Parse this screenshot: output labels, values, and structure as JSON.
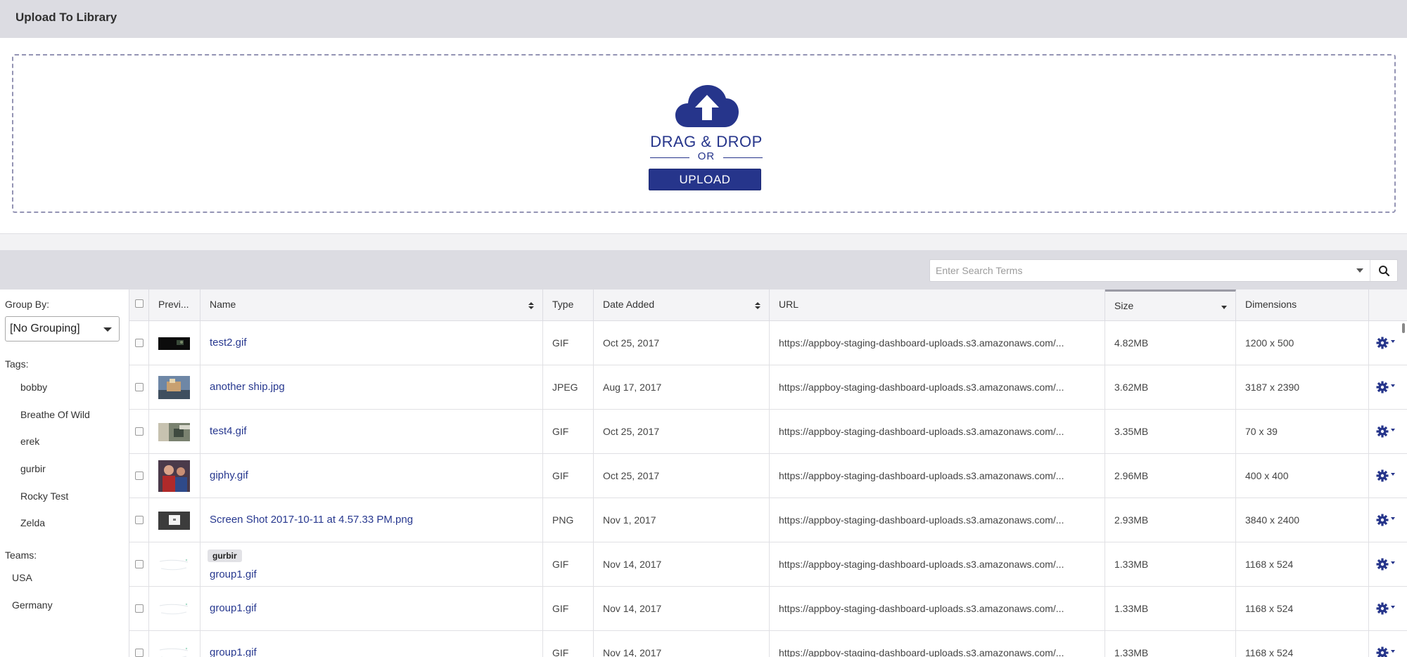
{
  "header": {
    "title": "Upload To Library"
  },
  "dropzone": {
    "drag_drop_text": "DRAG & DROP",
    "or_text": "OR",
    "upload_label": "UPLOAD"
  },
  "search": {
    "placeholder": "Enter Search Terms"
  },
  "sidebar": {
    "group_by_label": "Group By:",
    "group_by_value": "[No Grouping]",
    "tags_label": "Tags:",
    "tags": [
      "bobby",
      "Breathe Of Wild",
      "erek",
      "gurbir",
      "Rocky Test",
      "Zelda"
    ],
    "teams_label": "Teams:",
    "teams": [
      "USA",
      "Germany"
    ]
  },
  "table": {
    "columns": {
      "preview": "Previ...",
      "name": "Name",
      "type": "Type",
      "date_added": "Date Added",
      "url": "URL",
      "size": "Size",
      "dimensions": "Dimensions"
    },
    "sorted_column": "Size",
    "rows": [
      {
        "name": "test2.gif",
        "tag": "",
        "type": "GIF",
        "date": "Oct 25, 2017",
        "url": "https://appboy-staging-dashboard-uploads.s3.amazonaws.com/...",
        "size": "4.82MB",
        "dimensions": "1200 x 500",
        "thumb": "dark-banner"
      },
      {
        "name": "another ship.jpg",
        "tag": "",
        "type": "JPEG",
        "date": "Aug 17, 2017",
        "url": "https://appboy-staging-dashboard-uploads.s3.amazonaws.com/...",
        "size": "3.62MB",
        "dimensions": "3187 x 2390",
        "thumb": "ship-photo"
      },
      {
        "name": "test4.gif",
        "tag": "",
        "type": "GIF",
        "date": "Oct 25, 2017",
        "url": "https://appboy-staging-dashboard-uploads.s3.amazonaws.com/...",
        "size": "3.35MB",
        "dimensions": "70 x 39",
        "thumb": "street-photo"
      },
      {
        "name": "giphy.gif",
        "tag": "",
        "type": "GIF",
        "date": "Oct 25, 2017",
        "url": "https://appboy-staging-dashboard-uploads.s3.amazonaws.com/...",
        "size": "2.96MB",
        "dimensions": "400 x 400",
        "thumb": "people-photo"
      },
      {
        "name": "Screen Shot 2017-10-11 at 4.57.33 PM.png",
        "tag": "",
        "type": "PNG",
        "date": "Nov 1, 2017",
        "url": "https://appboy-staging-dashboard-uploads.s3.amazonaws.com/...",
        "size": "2.93MB",
        "dimensions": "3840 x 2400",
        "thumb": "screenshot"
      },
      {
        "name": "group1.gif",
        "tag": "gurbir",
        "type": "GIF",
        "date": "Nov 14, 2017",
        "url": "https://appboy-staging-dashboard-uploads.s3.amazonaws.com/...",
        "size": "1.33MB",
        "dimensions": "1168 x 524",
        "thumb": "light-sketch"
      },
      {
        "name": "group1.gif",
        "tag": "",
        "type": "GIF",
        "date": "Nov 14, 2017",
        "url": "https://appboy-staging-dashboard-uploads.s3.amazonaws.com/...",
        "size": "1.33MB",
        "dimensions": "1168 x 524",
        "thumb": "light-sketch"
      },
      {
        "name": "group1.gif",
        "tag": "",
        "type": "GIF",
        "date": "Nov 14, 2017",
        "url": "https://appboy-staging-dashboard-uploads.s3.amazonaws.com/...",
        "size": "1.33MB",
        "dimensions": "1168 x 524",
        "thumb": "light-sketch"
      }
    ]
  },
  "colors": {
    "accent": "#26358b",
    "link": "#27388f",
    "header_bg": "#dcdce2"
  }
}
